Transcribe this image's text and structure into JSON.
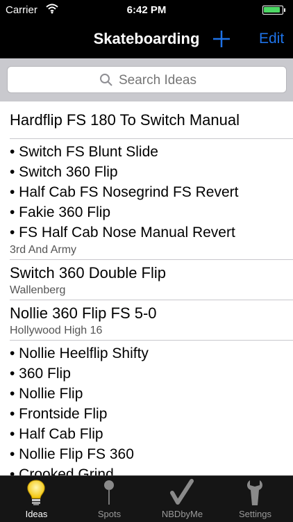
{
  "status_bar": {
    "carrier": "Carrier",
    "time": "6:42 PM",
    "battery_color": "#4cd964"
  },
  "nav": {
    "title": "Skateboarding",
    "add_icon": "plus-icon",
    "edit_label": "Edit",
    "accent": "#1e73e8"
  },
  "search": {
    "placeholder": "Search Ideas",
    "value": ""
  },
  "list": {
    "items": [
      {
        "title": "Hardflip FS 180 To Switch Manual"
      },
      {
        "bullets": [
          "• Switch FS Blunt Slide",
          "• Switch 360 Flip",
          "• Half Cab FS Nosegrind FS Revert",
          "• Fakie 360 Flip",
          "• FS Half Cab Nose Manual Revert"
        ],
        "subtitle": "3rd And Army"
      },
      {
        "title": "Switch 360 Double Flip",
        "subtitle": "Wallenberg"
      },
      {
        "title": "Nollie 360 Flip FS 5-0",
        "subtitle": "Hollywood High 16"
      },
      {
        "bullets": [
          "• Nollie Heelflip Shifty",
          "• 360 Flip",
          "• Nollie Flip",
          "• Frontside Flip",
          "• Half Cab Flip",
          "• Nollie Flip FS 360",
          "• Crooked Grind"
        ]
      }
    ]
  },
  "tabs": [
    {
      "label": "Ideas",
      "icon": "lightbulb-icon",
      "active": true
    },
    {
      "label": "Spots",
      "icon": "pin-icon",
      "active": false
    },
    {
      "label": "NBDbyMe",
      "icon": "checkmark-icon",
      "active": false
    },
    {
      "label": "Settings",
      "icon": "wrench-icon",
      "active": false
    }
  ]
}
